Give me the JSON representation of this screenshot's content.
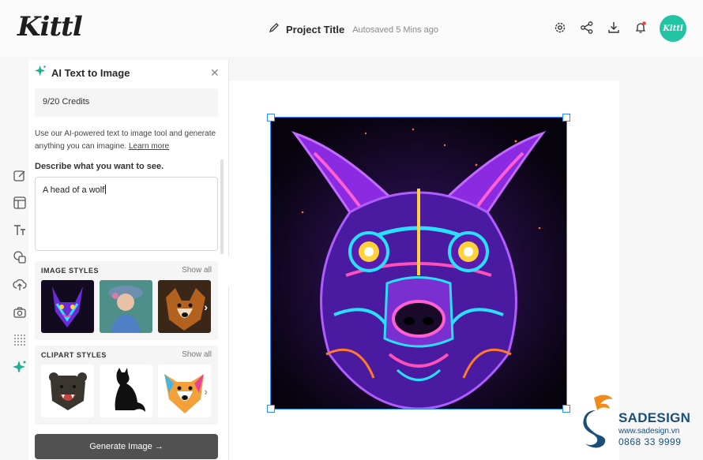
{
  "header": {
    "logo": "Kittl",
    "project_title": "Project Title",
    "autosave": "Autosaved 5 Mins ago",
    "icons": [
      "gear-icon",
      "share-icon",
      "download-icon",
      "bell-icon"
    ],
    "avatar": "Kittl"
  },
  "rail": {
    "icons": [
      "edit-icon",
      "layout-icon",
      "text-icon",
      "shapes-icon",
      "upload-icon",
      "camera-icon",
      "dots-grid-icon",
      "sparkle-icon"
    ]
  },
  "panel": {
    "title": "AI Text to Image",
    "credits": "9/20  Credits",
    "desc_text": "Use our AI-powered text to image tool and generate anything you can imagine.",
    "learn_more": "Learn more",
    "prompt_label": "Describe what you want to see.",
    "prompt_value": "A head of a wolf",
    "image_styles": {
      "heading": "IMAGE STYLES",
      "show_all": "Show all",
      "thumbs": [
        "neon-wolf",
        "portrait-painting",
        "dog-photo"
      ]
    },
    "clipart_styles": {
      "heading": "CLIPART STYLES",
      "show_all": "Show all",
      "thumbs": [
        "bear-clipart",
        "cat-silhouette",
        "colorful-dog"
      ]
    },
    "generate_button": "Generate Image →"
  },
  "watermark": {
    "brand": "SADESIGN",
    "url": "www.sadesign.vn",
    "phone": "0868 33 9999"
  },
  "colors": {
    "accent": "#22c4a4",
    "selection": "#2a8cff",
    "button": "#515151"
  }
}
